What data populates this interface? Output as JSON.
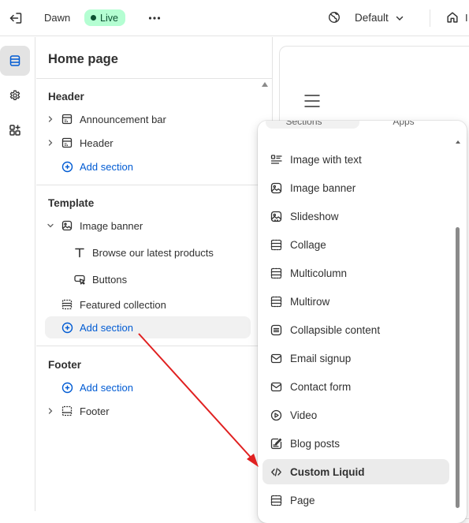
{
  "topbar": {
    "theme_name": "Dawn",
    "live_badge": "Live",
    "template_select": "Default",
    "home_label_partial": "I"
  },
  "panel": {
    "title": "Home page",
    "header_group": {
      "title": "Header",
      "items": [
        "Announcement bar",
        "Header"
      ],
      "add_label": "Add section"
    },
    "template_group": {
      "title": "Template",
      "image_banner": "Image banner",
      "blocks": [
        "Browse our latest products",
        "Buttons"
      ],
      "featured": "Featured collection",
      "add_label": "Add section"
    },
    "footer_group": {
      "title": "Footer",
      "add_label": "Add section",
      "items": [
        "Footer"
      ]
    }
  },
  "dropdown": {
    "tabs": [
      "Sections",
      "Apps"
    ],
    "items": [
      {
        "label": "Image with text",
        "icon": "image-with-text-icon"
      },
      {
        "label": "Image banner",
        "icon": "image-icon"
      },
      {
        "label": "Slideshow",
        "icon": "slideshow-icon"
      },
      {
        "label": "Collage",
        "icon": "layout-icon"
      },
      {
        "label": "Multicolumn",
        "icon": "columns-icon"
      },
      {
        "label": "Multirow",
        "icon": "rows-icon"
      },
      {
        "label": "Collapsible content",
        "icon": "collapsible-icon"
      },
      {
        "label": "Email signup",
        "icon": "email-icon"
      },
      {
        "label": "Contact form",
        "icon": "email-icon"
      },
      {
        "label": "Video",
        "icon": "play-icon"
      },
      {
        "label": "Blog posts",
        "icon": "blog-icon"
      },
      {
        "label": "Custom Liquid",
        "icon": "code-icon"
      },
      {
        "label": "Page",
        "icon": "page-icon"
      }
    ],
    "highlighted": "Custom Liquid"
  },
  "colors": {
    "accent": "#005bd3",
    "live_badge_bg": "#b4fed2",
    "annotation_arrow": "#e02020"
  }
}
